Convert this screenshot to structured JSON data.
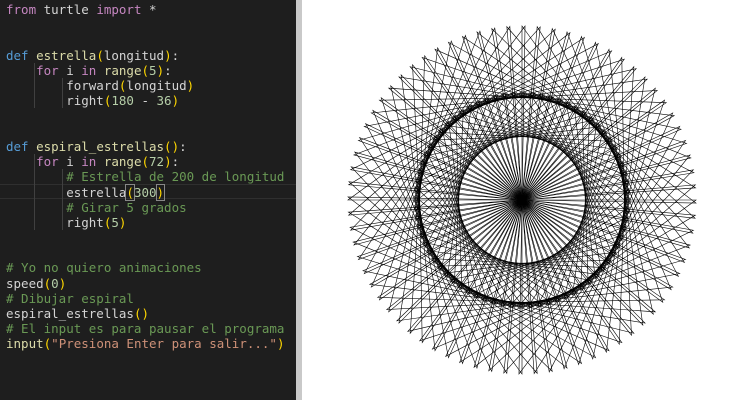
{
  "editor": {
    "lines": [
      [
        {
          "t": "from",
          "c": "kw"
        },
        {
          "t": " turtle ",
          "c": "id"
        },
        {
          "t": "import",
          "c": "kw"
        },
        {
          "t": " *",
          "c": "id"
        }
      ],
      [],
      [],
      [
        {
          "t": "def",
          "c": "def"
        },
        {
          "t": " ",
          "c": "id"
        },
        {
          "t": "estrella",
          "c": "fn"
        },
        {
          "t": "(",
          "c": "br"
        },
        {
          "t": "longitud",
          "c": "id"
        },
        {
          "t": ")",
          "c": "br"
        },
        {
          "t": ":",
          "c": "id"
        }
      ],
      [
        {
          "t": "    ",
          "c": "id"
        },
        {
          "t": "for",
          "c": "kw"
        },
        {
          "t": " i ",
          "c": "id"
        },
        {
          "t": "in",
          "c": "kw"
        },
        {
          "t": " ",
          "c": "id"
        },
        {
          "t": "range",
          "c": "fn"
        },
        {
          "t": "(",
          "c": "br"
        },
        {
          "t": "5",
          "c": "num"
        },
        {
          "t": ")",
          "c": "br"
        },
        {
          "t": ":",
          "c": "id"
        }
      ],
      [
        {
          "t": "        forward",
          "c": "id"
        },
        {
          "t": "(",
          "c": "br"
        },
        {
          "t": "longitud",
          "c": "id"
        },
        {
          "t": ")",
          "c": "br"
        }
      ],
      [
        {
          "t": "        right",
          "c": "id"
        },
        {
          "t": "(",
          "c": "br"
        },
        {
          "t": "180",
          "c": "num"
        },
        {
          "t": " - ",
          "c": "id"
        },
        {
          "t": "36",
          "c": "num"
        },
        {
          "t": ")",
          "c": "br"
        }
      ],
      [],
      [],
      [
        {
          "t": "def",
          "c": "def"
        },
        {
          "t": " ",
          "c": "id"
        },
        {
          "t": "espiral_estrellas",
          "c": "fn"
        },
        {
          "t": "(",
          "c": "br"
        },
        {
          "t": ")",
          "c": "br"
        },
        {
          "t": ":",
          "c": "id"
        }
      ],
      [
        {
          "t": "    ",
          "c": "id"
        },
        {
          "t": "for",
          "c": "kw"
        },
        {
          "t": " i ",
          "c": "id"
        },
        {
          "t": "in",
          "c": "kw"
        },
        {
          "t": " ",
          "c": "id"
        },
        {
          "t": "range",
          "c": "fn"
        },
        {
          "t": "(",
          "c": "br"
        },
        {
          "t": "72",
          "c": "num"
        },
        {
          "t": ")",
          "c": "br"
        },
        {
          "t": ":",
          "c": "id"
        }
      ],
      [
        {
          "t": "        ",
          "c": "id"
        },
        {
          "t": "# Estrella de 200 de longitud",
          "c": "cm"
        }
      ],
      [
        {
          "t": "        estrella",
          "c": "id"
        },
        {
          "t": "(",
          "c": "br",
          "m": true
        },
        {
          "t": "300",
          "c": "num"
        },
        {
          "t": ")",
          "c": "br",
          "m": true
        }
      ],
      [
        {
          "t": "        ",
          "c": "id"
        },
        {
          "t": "# Girar 5 grados",
          "c": "cm"
        }
      ],
      [
        {
          "t": "        right",
          "c": "id"
        },
        {
          "t": "(",
          "c": "br"
        },
        {
          "t": "5",
          "c": "num"
        },
        {
          "t": ")",
          "c": "br"
        }
      ],
      [],
      [],
      [
        {
          "t": "# Yo no quiero animaciones",
          "c": "cm"
        }
      ],
      [
        {
          "t": "speed",
          "c": "id"
        },
        {
          "t": "(",
          "c": "br"
        },
        {
          "t": "0",
          "c": "num"
        },
        {
          "t": ")",
          "c": "br"
        }
      ],
      [
        {
          "t": "# Dibujar espiral",
          "c": "cm"
        }
      ],
      [
        {
          "t": "espiral_estrellas",
          "c": "id"
        },
        {
          "t": "(",
          "c": "br"
        },
        {
          "t": ")",
          "c": "br"
        }
      ],
      [
        {
          "t": "# El input es para pausar el programa",
          "c": "cm"
        }
      ],
      [
        {
          "t": "input",
          "c": "fn"
        },
        {
          "t": "(",
          "c": "br"
        },
        {
          "t": "\"Presiona Enter para salir...\"",
          "c": "str"
        },
        {
          "t": ")",
          "c": "br"
        }
      ]
    ],
    "current_line": 12
  },
  "drawing": {
    "star_count": 72,
    "star_side": 300,
    "star_turn_degrees": 144,
    "spiral_turn_degrees": 5,
    "stroke_color": "#000000",
    "background": "#ffffff"
  },
  "colors": {
    "editor_bg": "#1e1e1e",
    "keyword": "#c586c0",
    "def": "#569cd6",
    "function": "#dcdcaa",
    "number": "#b5cea8",
    "comment": "#6a9955",
    "string": "#ce9178",
    "text": "#d4d4d4",
    "bracket": "#ffd700"
  }
}
